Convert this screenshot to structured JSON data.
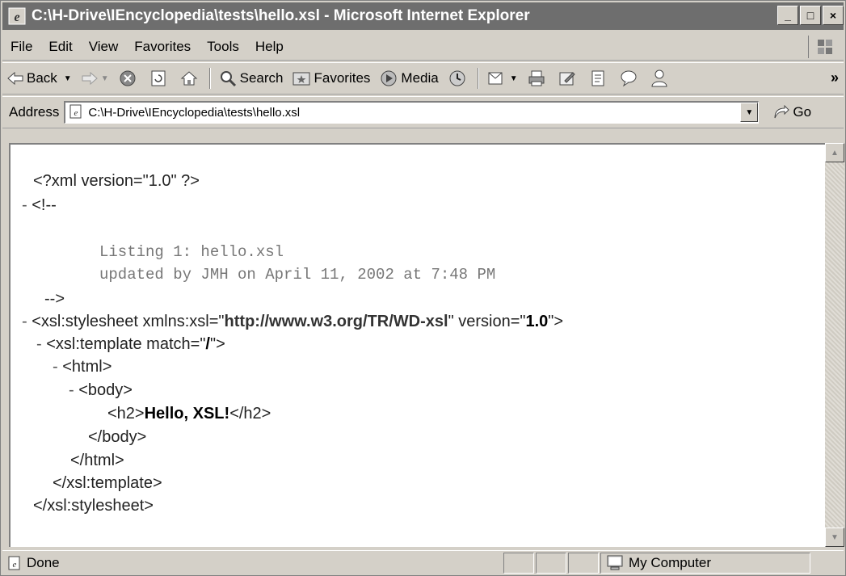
{
  "window": {
    "title": "C:\\H-Drive\\IEncyclopedia\\tests\\hello.xsl - Microsoft Internet Explorer",
    "min_label": "_",
    "max_label": "□",
    "close_label": "×"
  },
  "menu": [
    "File",
    "Edit",
    "View",
    "Favorites",
    "Tools",
    "Help"
  ],
  "toolbar": {
    "back_label": "Back",
    "search_label": "Search",
    "favorites_label": "Favorites",
    "media_label": "Media",
    "more_label": "»"
  },
  "address": {
    "label": "Address",
    "value": "C:\\H-Drive\\IEncyclopedia\\tests\\hello.xsl",
    "go_label": "Go"
  },
  "content": {
    "pi": "<?xml version=\"1.0\" ?>",
    "dash": "-",
    "comment_open": "<!--",
    "comment_line1": "Listing 1: hello.xsl",
    "comment_line2": "updated by JMH on April 11, 2002 at 7:48 PM",
    "comment_close": "-->",
    "stylesheet_open_prefix": "<xsl:stylesheet xmlns:xsl=\"",
    "stylesheet_ns": "http://www.w3.org/TR/WD-xsl",
    "stylesheet_mid": "\" version=\"",
    "stylesheet_version": "1.0",
    "stylesheet_open_suffix": "\">",
    "template_prefix": "<xsl:template match=\"",
    "template_match": "/",
    "template_suffix": "\">",
    "html_open": "<html>",
    "body_open": "<body>",
    "h2_open": "<h2>",
    "h2_text": "Hello, XSL!",
    "h2_close": "</h2>",
    "body_close": "</body>",
    "html_close": "</html>",
    "template_close": "</xsl:template>",
    "stylesheet_close": "</xsl:stylesheet>"
  },
  "status": {
    "text": "Done",
    "zone": "My Computer"
  },
  "colors": {
    "titlebar": "#6e6e6e",
    "chrome": "#d4d0c8",
    "content_bg": "#ffffff"
  }
}
